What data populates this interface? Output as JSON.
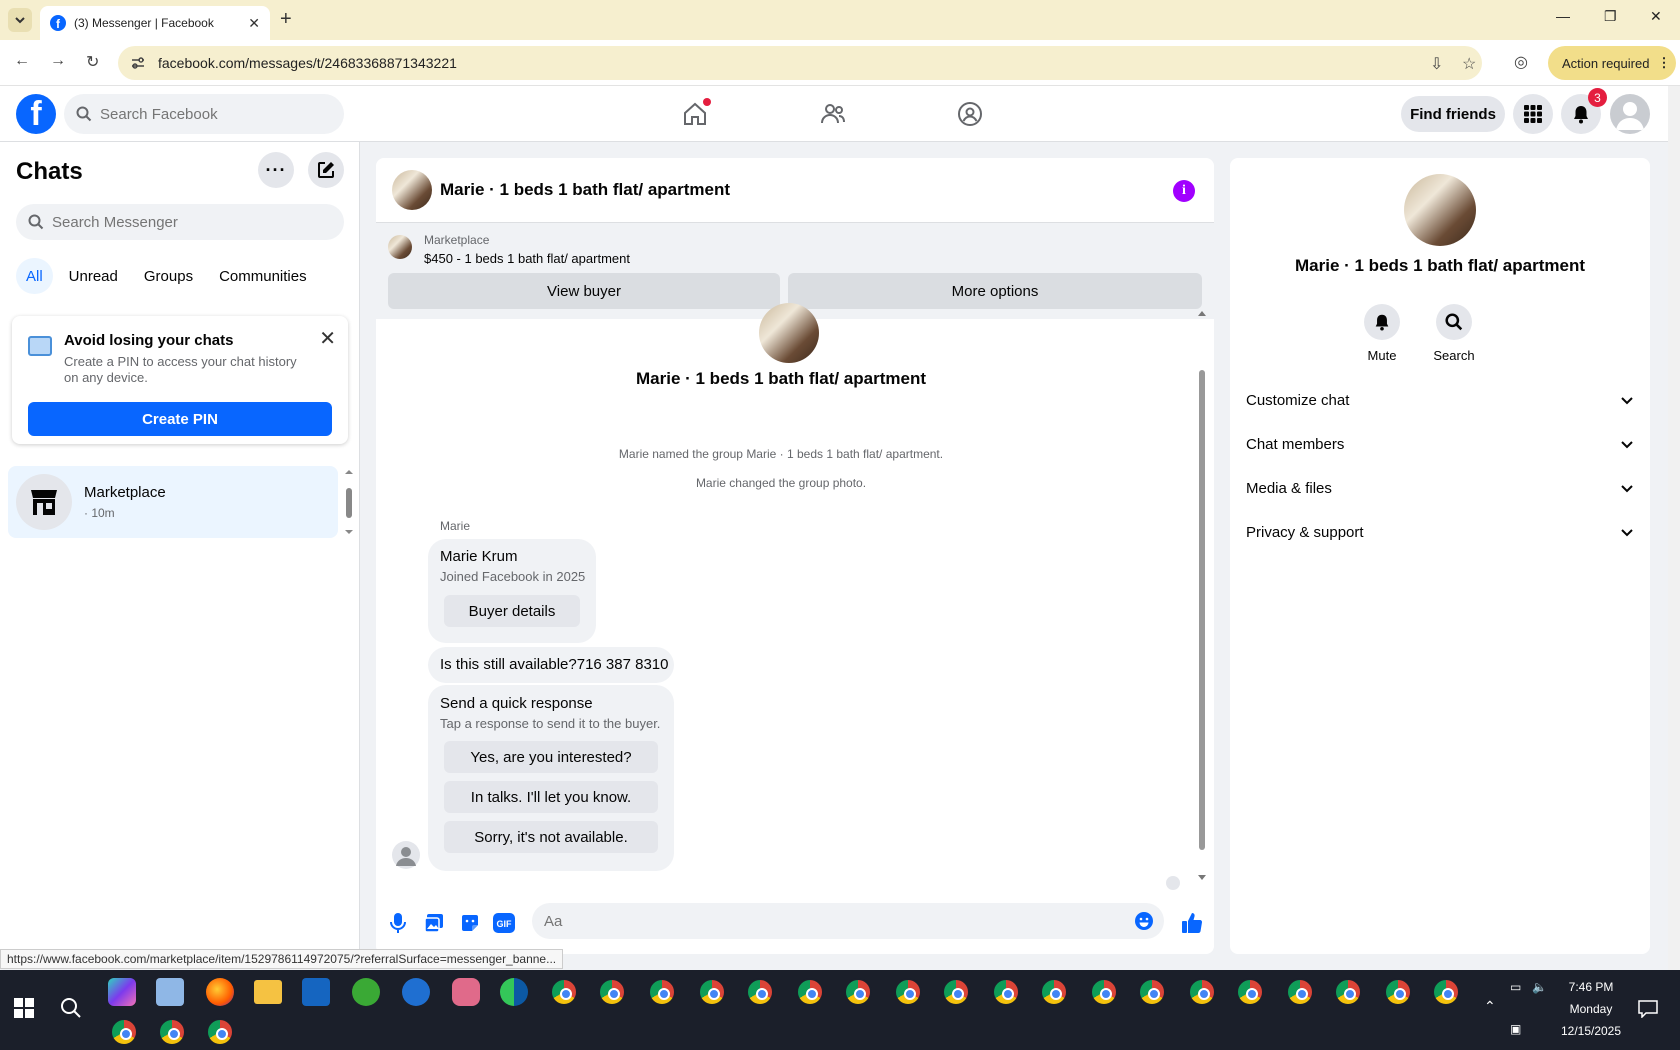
{
  "browser": {
    "tab_title": "(3) Messenger | Facebook",
    "url": "facebook.com/messages/t/24683368871343221",
    "action_required": "Action required",
    "status_url": "https://www.facebook.com/marketplace/item/1529786114972075/?referralSurface=messenger_banne..."
  },
  "header": {
    "logo": "f",
    "search_placeholder": "Search Facebook",
    "find_friends": "Find friends",
    "notifications_count": "3"
  },
  "left": {
    "title": "Chats",
    "search_placeholder": "Search Messenger",
    "filters": [
      "All",
      "Unread",
      "Groups",
      "Communities"
    ],
    "pin_card": {
      "title": "Avoid losing your chats",
      "desc": "Create a PIN to access your chat history on any device.",
      "button": "Create PIN"
    },
    "chat": {
      "name": "Marketplace",
      "meta": "· 10m"
    }
  },
  "conversation": {
    "title": "Marie · 1 beds 1 bath flat/ apartment",
    "marketplace_label": "Marketplace",
    "listing": "$450 - 1 beds 1 bath flat/ apartment",
    "view_buyer": "View buyer",
    "more_options": "More options",
    "thread_title": "Marie · 1 beds 1 bath flat/ apartment",
    "sys1": "Marie named the group Marie · 1 beds 1 bath flat/ apartment.",
    "sys2": "Marie changed the group photo.",
    "sender": "Marie",
    "card_name": "Marie Krum",
    "card_sub": "Joined Facebook in 2025",
    "buyer_details": "Buyer details",
    "message": "Is this still available?716 387 8310",
    "quick_title": "Send a quick response",
    "quick_sub": "Tap a response to send it to the buyer.",
    "quick_responses": [
      "Yes, are you interested?",
      "In talks. I'll let you know.",
      "Sorry, it's not available."
    ],
    "composer_placeholder": "Aa",
    "gif": "GIF"
  },
  "info": {
    "title": "Marie · 1 beds 1 bath flat/ apartment",
    "mute": "Mute",
    "search": "Search",
    "sections": [
      "Customize chat",
      "Chat members",
      "Media & files",
      "Privacy & support"
    ]
  },
  "taskbar": {
    "time": "7:46 PM",
    "day": "Monday",
    "date": "12/15/2025"
  },
  "colors": {
    "fb_blue": "#0866ff",
    "accent_purple": "#a100ff",
    "notif_red": "#e41e3f"
  }
}
